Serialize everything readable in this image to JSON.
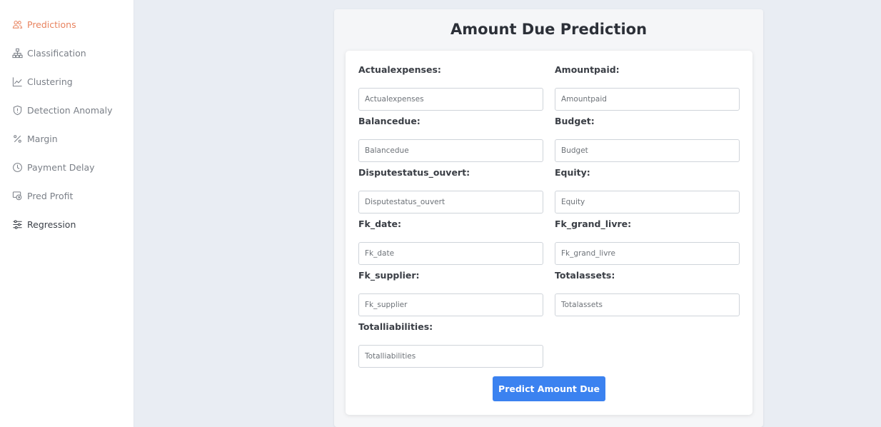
{
  "sidebar": {
    "items": [
      {
        "label": "Predictions",
        "icon": "users-icon"
      },
      {
        "label": "Classification",
        "icon": "hierarchy-icon"
      },
      {
        "label": "Clustering",
        "icon": "line-chart-icon"
      },
      {
        "label": "Detection Anomaly",
        "icon": "shield-icon"
      },
      {
        "label": "Margin",
        "icon": "percent-icon"
      },
      {
        "label": "Payment Delay",
        "icon": "clock-icon"
      },
      {
        "label": "Pred Profit",
        "icon": "money-icon"
      },
      {
        "label": "Regression",
        "icon": "sliders-icon"
      }
    ],
    "active_color": "#e8835f"
  },
  "main": {
    "title": "Amount Due Prediction",
    "fields": [
      {
        "label": "Actualexpenses:",
        "placeholder": "Actualexpenses"
      },
      {
        "label": "Amountpaid:",
        "placeholder": "Amountpaid"
      },
      {
        "label": "Balancedue:",
        "placeholder": "Balancedue"
      },
      {
        "label": "Budget:",
        "placeholder": "Budget"
      },
      {
        "label": "Disputestatus_ouvert:",
        "placeholder": "Disputestatus_ouvert"
      },
      {
        "label": "Equity:",
        "placeholder": "Equity"
      },
      {
        "label": "Fk_date:",
        "placeholder": "Fk_date"
      },
      {
        "label": "Fk_grand_livre:",
        "placeholder": "Fk_grand_livre"
      },
      {
        "label": "Fk_supplier:",
        "placeholder": "Fk_supplier"
      },
      {
        "label": "Totalassets:",
        "placeholder": "Totalassets"
      },
      {
        "label": "Totalliabilities:",
        "placeholder": "Totalliabilities"
      }
    ],
    "submit_label": "Predict Amount Due",
    "accent_color": "#3b82f0"
  }
}
